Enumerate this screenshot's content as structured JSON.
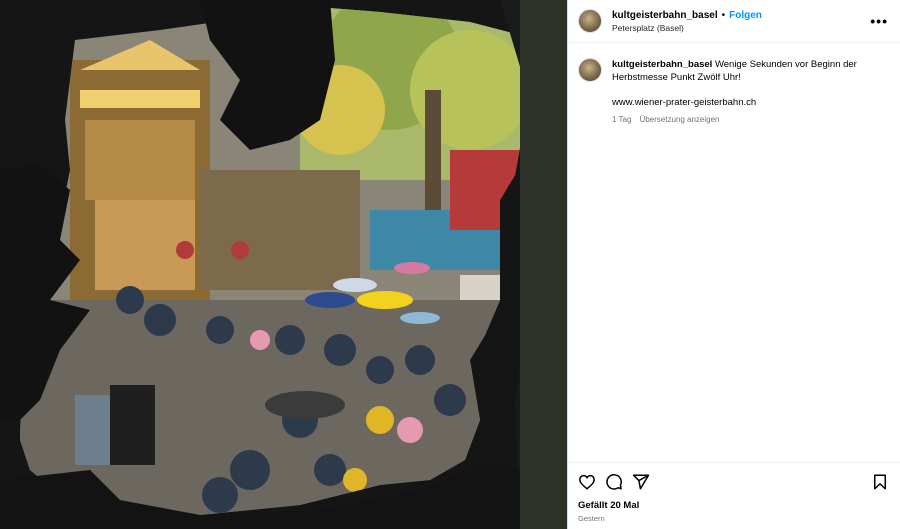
{
  "post": {
    "username": "kultgeisterbahn_basel",
    "follow_label": "Folgen",
    "location": "Petersplatz (Basel)",
    "more_label": "•••",
    "caption_text": "Wenige Sekunden vor Beginn der Herbstmesse Punkt Zwölf Uhr!",
    "link_text": "www.wiener-prater-geisterbahn.ch",
    "time_ago": "1 Tag",
    "translate_label": "Übersetzung anzeigen",
    "likes_text": "Gefällt 20 Mal",
    "date_text": "Gestern"
  },
  "icons": {
    "like": "heart-icon",
    "comment": "comment-icon",
    "share": "share-icon",
    "save": "bookmark-icon",
    "more": "more-icon"
  },
  "colors": {
    "accent": "#0095f6",
    "secondary_text": "#737373",
    "border": "#dbdbdb"
  }
}
